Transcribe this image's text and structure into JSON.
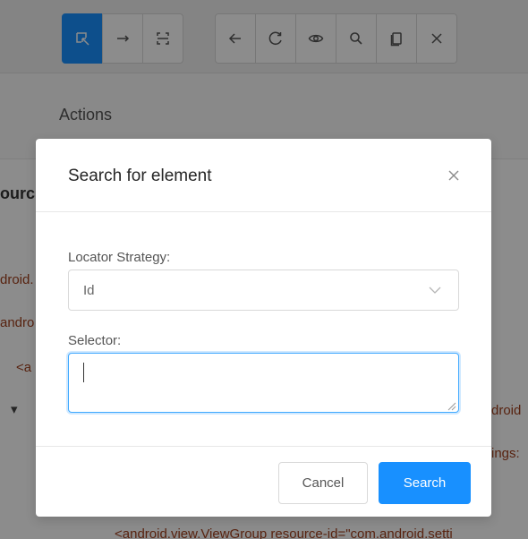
{
  "actions": {
    "label": "Actions"
  },
  "source": {
    "title_fragment": "ourc",
    "lines": [
      {
        "text": "droid."
      },
      {
        "text": "andro"
      },
      {
        "text": "<a"
      },
      {
        "text": "droid"
      },
      {
        "text": "ings:"
      },
      {
        "text": "<android.view.ViewGroup resource-id=\"com.android.setti"
      }
    ]
  },
  "modal": {
    "title": "Search for element",
    "locator_label": "Locator Strategy:",
    "locator_value": "Id",
    "selector_label": "Selector:",
    "selector_value": "",
    "cancel_label": "Cancel",
    "search_label": "Search"
  },
  "colors": {
    "accent": "#1890ff",
    "mask": "rgba(0,0,0,0.45)",
    "source_text": "#a0401e"
  },
  "icons": {
    "toolbar_left": [
      "select-element-icon",
      "swipe-arrow-icon",
      "tap-coordinates-icon"
    ],
    "toolbar_right": [
      "back-arrow-icon",
      "refresh-icon",
      "eye-icon",
      "search-icon",
      "copy-xml-icon",
      "quit-session-icon"
    ],
    "modal_close": "close-icon",
    "select_arrow": "chevron-down-icon"
  }
}
